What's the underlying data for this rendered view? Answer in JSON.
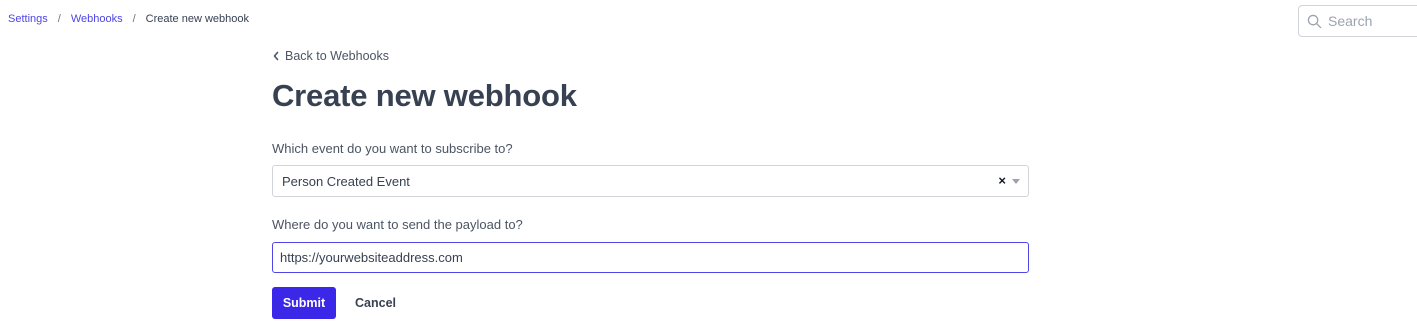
{
  "breadcrumb": {
    "items": [
      {
        "label": "Settings"
      },
      {
        "label": "Webhooks"
      },
      {
        "label": "Create new webhook"
      }
    ],
    "separator": "/"
  },
  "search": {
    "placeholder": "Search",
    "icon": "search-icon"
  },
  "back_link": {
    "label": "Back to Webhooks",
    "icon": "chevron-left-icon"
  },
  "page_title": "Create new webhook",
  "event_field": {
    "label": "Which event do you want to subscribe to?",
    "selected_value": "Person Created Event",
    "clear_glyph": "×"
  },
  "url_field": {
    "label": "Where do you want to send the payload to?",
    "value": "https://yourwebsiteaddress.com"
  },
  "actions": {
    "submit_label": "Submit",
    "cancel_label": "Cancel"
  },
  "colors": {
    "accent": "#4f46e5",
    "submit_bg": "#3b27e8",
    "text": "#374151"
  }
}
